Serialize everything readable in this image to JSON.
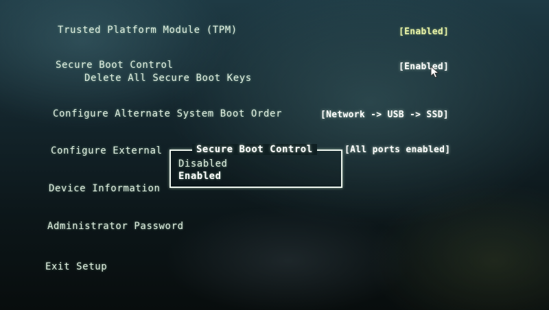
{
  "menu": {
    "items": [
      {
        "label": "Trusted Platform Module (TPM)",
        "value": "[Enabled]"
      },
      {
        "label": "Secure Boot Control",
        "value": "[Enabled]"
      },
      {
        "label": "Delete All Secure Boot Keys"
      },
      {
        "label": "Configure Alternate System Boot Order",
        "value": "[Network -> USB -> SSD]"
      },
      {
        "label": "Configure External",
        "value": "[All ports enabled]"
      },
      {
        "label": "Device Information"
      },
      {
        "label": "Administrator Password"
      },
      {
        "label": "Exit Setup"
      }
    ]
  },
  "popup": {
    "title": "Secure Boot Control",
    "options": [
      "Disabled",
      "Enabled"
    ],
    "selected": "Enabled"
  },
  "cursor": {
    "icon": "mouse-pointer-icon"
  },
  "colors": {
    "text": "#dfeee0",
    "value": "#e8f3a8",
    "popup_border": "#eef6ee",
    "background": "#14262d"
  }
}
